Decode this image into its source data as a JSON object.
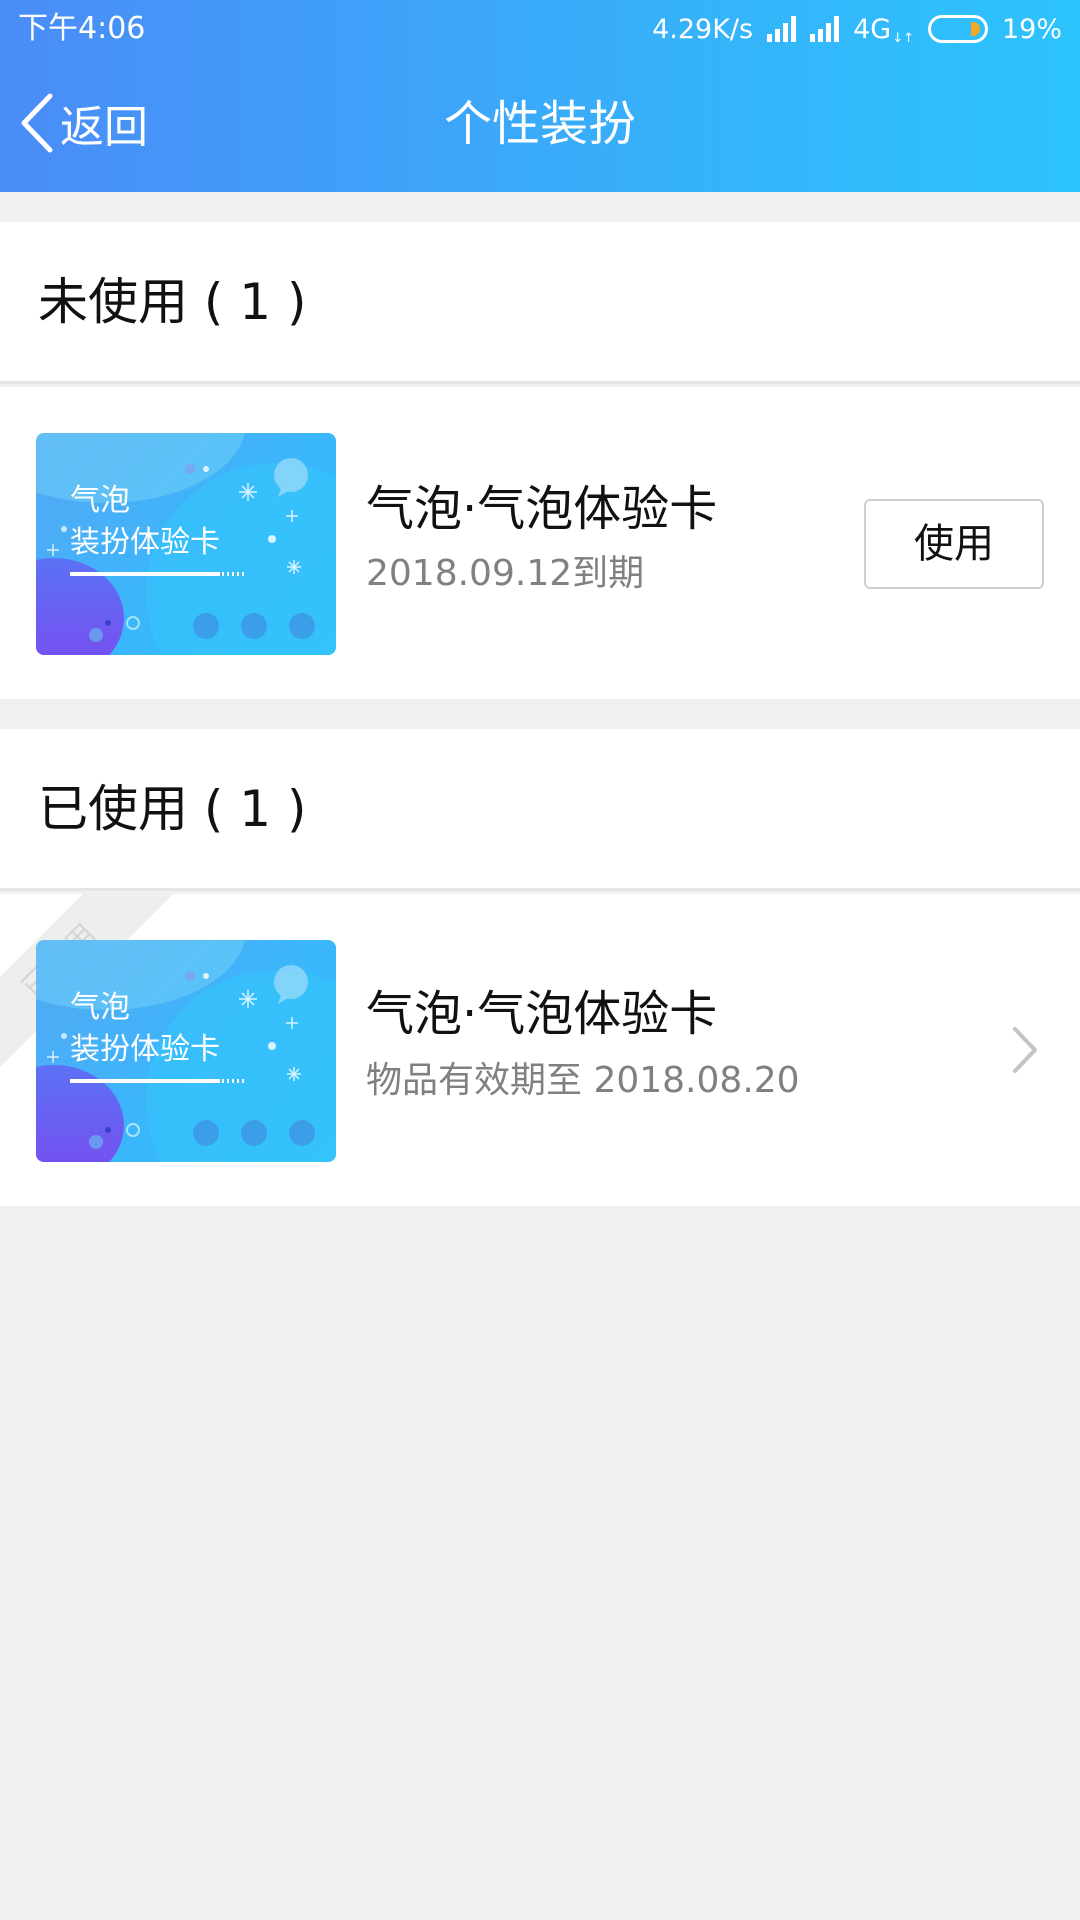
{
  "status_bar": {
    "time": "下午4:06",
    "speed": "4.29K/s",
    "network": "4G",
    "battery": "19%",
    "icons": [
      "signal-icon",
      "signal-icon",
      "battery-icon"
    ]
  },
  "header": {
    "back_label": "返回",
    "title": "个性装扮",
    "background_colors": [
      "#4a8cf7",
      "#2cc4fc"
    ]
  },
  "unused_section": {
    "title": "未使用 ( 1 )",
    "items": [
      {
        "card_line1": "气泡",
        "card_line2": "装扮体验卡",
        "title": "气泡·气泡体验卡",
        "subtitle": "2018.09.12到期",
        "action_label": "使用"
      }
    ]
  },
  "used_section": {
    "title": "已使用 ( 1 )",
    "items": [
      {
        "ribbon_label": "已使用",
        "card_line1": "气泡",
        "card_line2": "装扮体验卡",
        "title": "气泡·气泡体验卡",
        "subtitle": "物品有效期至 2018.08.20",
        "icon": "chevron-right-icon"
      }
    ]
  }
}
